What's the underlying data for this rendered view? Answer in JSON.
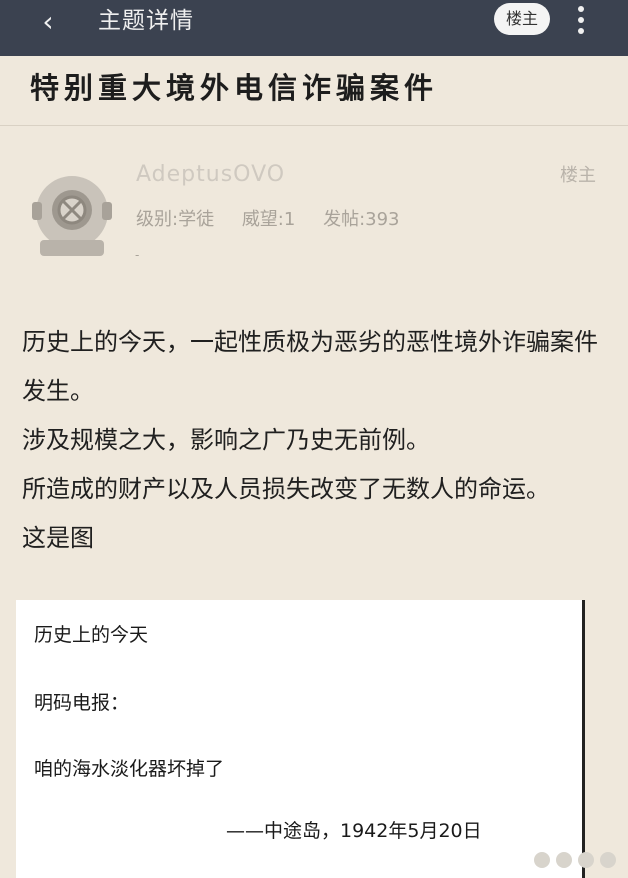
{
  "topbar": {
    "back_icon": "chevron-left-icon",
    "title": "主题详情",
    "owner_button": "楼主",
    "more_icon": "more-vertical-icon"
  },
  "thread": {
    "title": "特别重大境外电信诈骗案件"
  },
  "author": {
    "name": "AdeptusOVO",
    "floor": "楼主",
    "level_label": "级别:学徒",
    "reputation_label": "威望:1",
    "posts_label": "发帖:393",
    "dash": "-"
  },
  "post": {
    "paragraphs": [
      "历史上的今天，一起性质极为恶劣的恶性境外诈骗案件发生。",
      "涉及规模之大，影响之广乃史无前例。",
      "所造成的财产以及人员损失改变了无数人的命运。",
      "这是图"
    ]
  },
  "image": {
    "line1": "历史上的今天",
    "line2": "明码电报：",
    "line3": "咱的海水淡化器坏掉了",
    "signature": "——中途岛，1942年5月20日"
  }
}
